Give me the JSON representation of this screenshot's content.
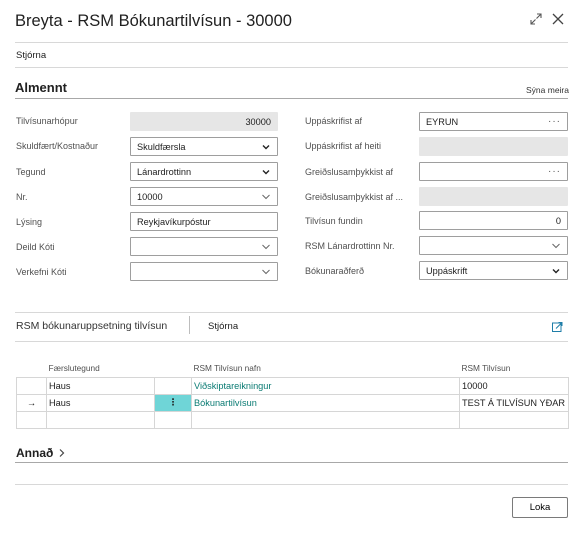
{
  "dialog": {
    "title": "Breyta - RSM Bókunartilvísun - 30000",
    "menu_label": "Stjórna",
    "close_label": "Loka"
  },
  "general": {
    "title": "Almennt",
    "show_more": "Sýna meira",
    "left_fields": [
      {
        "label": "Tilvísunarhópur",
        "value": "30000",
        "kind": "readonly"
      },
      {
        "label": "Skuldfært/Kostnaður",
        "value": "Skuldfærsla",
        "kind": "select"
      },
      {
        "label": "Tegund",
        "value": "Lánardrottinn",
        "kind": "select"
      },
      {
        "label": "Nr.",
        "value": "10000",
        "kind": "lookup"
      },
      {
        "label": "Lýsing",
        "value": "Reykjavíkurpóstur",
        "kind": "text"
      },
      {
        "label": "Deild Kóti",
        "value": "",
        "kind": "lookup"
      },
      {
        "label": "Verkefni Kóti",
        "value": "",
        "kind": "lookup"
      }
    ],
    "right_fields": [
      {
        "label": "Uppáskrifist af",
        "value": "EYRUN",
        "kind": "assist"
      },
      {
        "label": "Uppáskrifist af heiti",
        "value": "",
        "kind": "grey"
      },
      {
        "label": "Greiðslusamþykkist af",
        "value": "",
        "kind": "assist"
      },
      {
        "label": "Greiðslusamþykkist af ...",
        "value": "",
        "kind": "grey"
      },
      {
        "label": "Tilvísun fundin",
        "value": "0",
        "kind": "number"
      },
      {
        "label": "RSM Lánardrottinn Nr.",
        "value": "",
        "kind": "lookup"
      },
      {
        "label": "Bókunaraðferð",
        "value": "Uppáskrift",
        "kind": "select"
      }
    ]
  },
  "subpage": {
    "title": "RSM bókunaruppsetning tilvísun",
    "menu_label": "Stjórna",
    "columns": [
      "Færslutegund",
      "RSM Tilvísun nafn",
      "RSM Tilvísun"
    ],
    "rows": [
      {
        "indicator": "",
        "type": "Haus",
        "action": "",
        "name": "Viðskiptareikningur",
        "ref": "10000"
      },
      {
        "indicator": "→",
        "type": "Haus",
        "action": "⋮",
        "name": "Bókunartilvísun",
        "ref": "TEST Á TILVÍSUN YÐAR"
      },
      {
        "indicator": "",
        "type": "",
        "action": "",
        "name": "",
        "ref": ""
      }
    ]
  },
  "other": {
    "title": "Annað"
  },
  "icons": {
    "expand": "expand-icon",
    "close": "close-icon",
    "share": "open-in-new-icon",
    "chevron": "chevron-down-icon"
  },
  "colors": {
    "link": "#0a7b73",
    "selected_cell": "#6fd5d7"
  }
}
